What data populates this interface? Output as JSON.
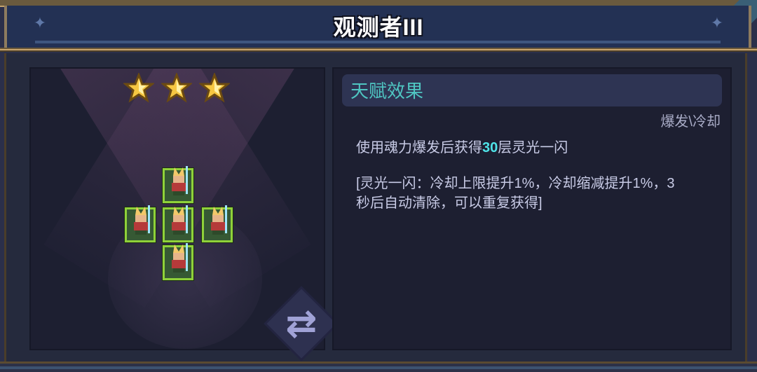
{
  "title": "观测者III",
  "star_count": 3,
  "talent": {
    "header": "天赋效果",
    "tags": "爆发\\冷却",
    "desc_prefix": "使用魂力爆发后获得",
    "desc_highlight": "30",
    "desc_suffix": "层灵光一闪",
    "note_line1": "[灵光一闪：冷却上限提升1%，冷却缩减提升1%，3",
    "note_line2": "秒后自动清除，可以重复获得]"
  },
  "colors": {
    "accent_teal": "#4fc6c2",
    "highlight_cyan": "#4fe3e8",
    "tile_border": "#8fd13a"
  },
  "icons": {
    "swap": "swap-icon",
    "star": "star-icon",
    "hero": "hero-sprite-icon"
  }
}
